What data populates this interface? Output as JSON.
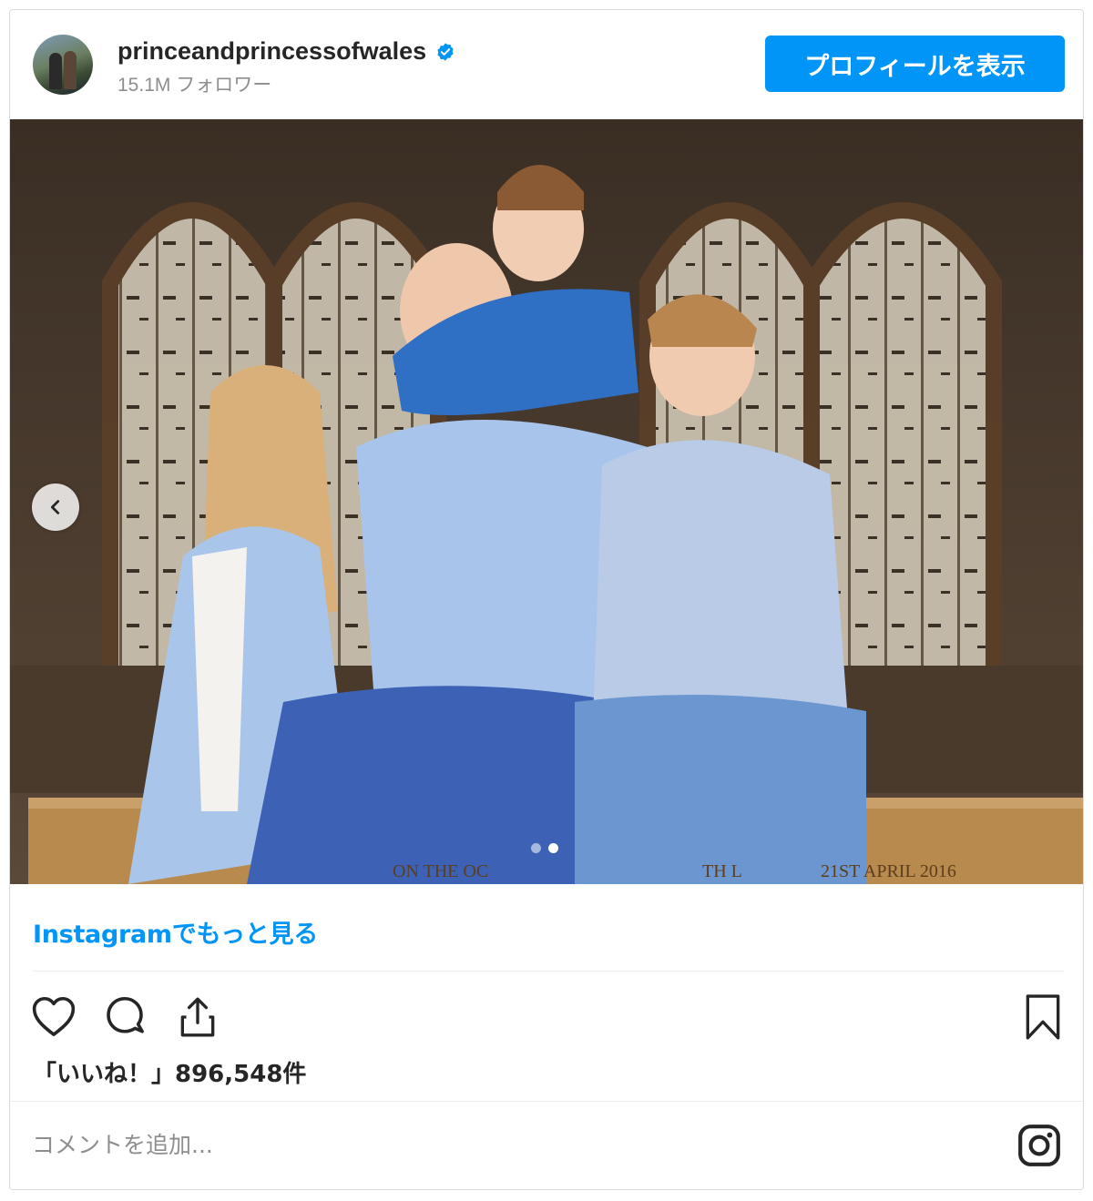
{
  "header": {
    "username": "princeandprincessofwales",
    "followers": "15.1M フォロワー",
    "profile_button": "プロフィールを表示"
  },
  "post": {
    "photo_caption_text": "ON THE OC   TH L   21ST APRIL 2016",
    "carousel": {
      "total": 2,
      "current": 2
    }
  },
  "links": {
    "more_on_instagram": "Instagramでもっと見る"
  },
  "actions": {
    "icons": [
      "heart-icon",
      "comment-icon",
      "share-icon",
      "bookmark-icon"
    ]
  },
  "likes": {
    "text": "「いいね！」896,548件"
  },
  "comment": {
    "placeholder": "コメントを追加..."
  },
  "colors": {
    "accent": "#0095f6",
    "text": "#262626",
    "muted": "#8e8e8e",
    "border": "#dbdbdb"
  }
}
